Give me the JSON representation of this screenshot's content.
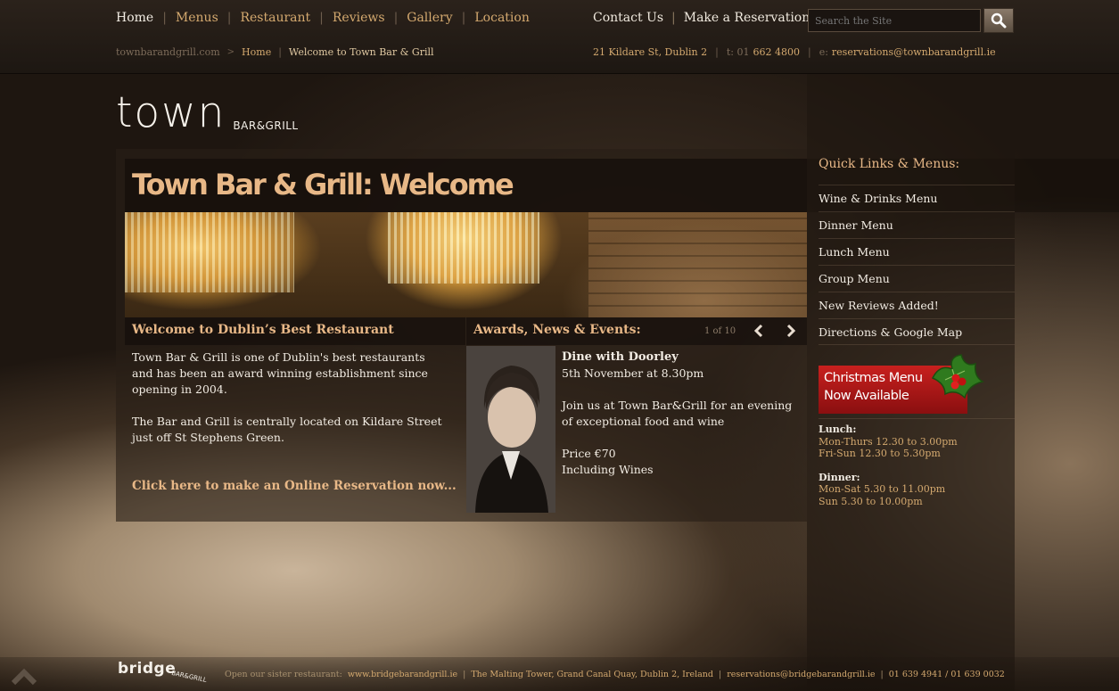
{
  "nav": {
    "items": [
      {
        "label": "Home",
        "active": true
      },
      {
        "label": "Menus"
      },
      {
        "label": "Restaurant"
      },
      {
        "label": "Reviews"
      },
      {
        "label": "Gallery"
      },
      {
        "label": "Location"
      }
    ],
    "separator": "|"
  },
  "right_nav": {
    "contact_label": "Contact Us",
    "reservation_label": "Make a Reservation"
  },
  "search": {
    "placeholder": "Search the Site"
  },
  "breadcrumb": {
    "root": "townbarandgrill.com",
    "home": "Home",
    "current": "Welcome to Town Bar & Grill"
  },
  "contact": {
    "address": "21 Kildare St, Dublin 2",
    "phone_label": "t: 01",
    "phone": "662 4800",
    "email_label": "e:",
    "email": "reservations@townbarandgrill.ie"
  },
  "logo": {
    "word": "town",
    "sub": "BAR&GRILL"
  },
  "page_title": "Town Bar & Grill: Welcome",
  "welcome": {
    "heading": "Welcome to Dublin’s Best Restaurant",
    "para1": "Town Bar & Grill is one of Dublin's best restaurants and has been an award winning establishment since opening in 2004.",
    "para2": "The Bar and Grill is centrally located on Kildare Street just off St Stephens Green.",
    "reservation_link": "Click here to make an Online Reservation now..."
  },
  "news": {
    "heading": "Awards, News & Events:",
    "pager": "1 of 10",
    "title": "Dine with Doorley",
    "date": "5th November at 8.30pm",
    "body": "Join us at Town Bar&Grill for an evening of exceptional food and wine",
    "price": "Price €70",
    "price_note": "Including Wines"
  },
  "sidebar": {
    "heading": "Quick Links & Menus:",
    "links": [
      "Wine & Drinks Menu",
      "Dinner Menu",
      "Lunch Menu",
      "Group Menu",
      "New Reviews Added!",
      "Directions & Google Map"
    ],
    "xmas_line1": "Christmas Menu",
    "xmas_line2": "Now Available",
    "lunch_title": "Lunch:",
    "lunch_1": "Mon-Thurs 12.30 to 3.00pm",
    "lunch_2": "Fri-Sun 12.30 to 5.30pm",
    "dinner_title": "Dinner:",
    "dinner_1": "Mon-Sat 5.30 to 11.00pm",
    "dinner_2": "Sun 5.30 to 10.00pm"
  },
  "footer": {
    "bridge_word": "bridge",
    "bridge_sub": "BAR&GRILL",
    "sister_label": "Open our sister restaurant:",
    "sister_url": "www.bridgebarandgrill.ie",
    "address": "The Malting Tower, Grand Canal Quay, Dublin 2, Ireland",
    "email": "reservations@bridgebarandgrill.ie",
    "phones": "01 639 4941 / 01 639 0032"
  },
  "colors": {
    "accent": "#d4a96f",
    "heading": "#e8b887",
    "xmas_red": "#c8201e"
  }
}
